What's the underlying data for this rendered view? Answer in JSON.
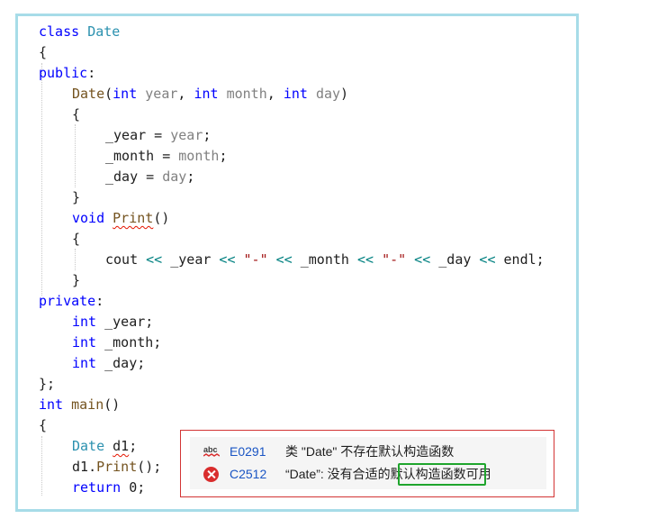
{
  "code": {
    "l1": {
      "kw": "class",
      "name": "Date"
    },
    "l2": "{",
    "l3": {
      "kw": "public",
      "colon": ":"
    },
    "l4": {
      "ctor": "Date",
      "open": "(",
      "t1": "int",
      "p1": "year",
      "comma1": ", ",
      "t2": "int",
      "p2": "month",
      "comma2": ", ",
      "t3": "int",
      "p3": "day",
      "close": ")"
    },
    "l5": "{",
    "l6": {
      "member": "_year",
      "eq": " = ",
      "param": "year",
      "semi": ";"
    },
    "l7": {
      "member": "_month",
      "eq": " = ",
      "param": "month",
      "semi": ";"
    },
    "l8": {
      "member": "_day",
      "eq": " = ",
      "param": "day",
      "semi": ";"
    },
    "l9": "}",
    "l10": {
      "kw": "void",
      "fn": "Print",
      "parens": "()"
    },
    "l11": "{",
    "l12": {
      "cout": "cout",
      "op1": " << ",
      "m1": "_year",
      "op2": " << ",
      "s1": "\"-\"",
      "op3": " << ",
      "m2": "_month",
      "op4": " << ",
      "s2": "\"-\"",
      "op5": " << ",
      "m3": "_day",
      "op6": " << ",
      "endl": "endl",
      "semi": ";"
    },
    "l13": "}",
    "l14": {
      "kw": "private",
      "colon": ":"
    },
    "l15": {
      "kw": "int",
      "rest": " _year;"
    },
    "l16": {
      "kw": "int",
      "rest": " _month;"
    },
    "l17": {
      "kw": "int",
      "rest": " _day;"
    },
    "l18": "};",
    "l19": {
      "kw": "int",
      "fn": "main",
      "parens": "()"
    },
    "l20": "{",
    "l21": {
      "type": "Date",
      "var": "d1",
      "semi": ";"
    },
    "l22": {
      "obj": "d1",
      "dot": ".",
      "fn": "Print",
      "rest": "();"
    },
    "l23": {
      "kw": "return",
      "rest": " 0;"
    }
  },
  "errors": [
    {
      "icon": "spell-check-icon",
      "code": "E0291",
      "message": "类 \"Date\" 不存在默认构造函数"
    },
    {
      "icon": "error-x-icon",
      "code": "C2512",
      "message": "“Date”: 没有合适的默认构造函数可用"
    }
  ],
  "colors": {
    "keyword": "#0000ff",
    "type": "#2b91af",
    "function": "#74531f",
    "parameter": "#808080",
    "operator": "#008080",
    "string": "#a31515",
    "error": "#d92d2d",
    "highlight": "#1fa52d",
    "frame": "#a7dce8"
  }
}
